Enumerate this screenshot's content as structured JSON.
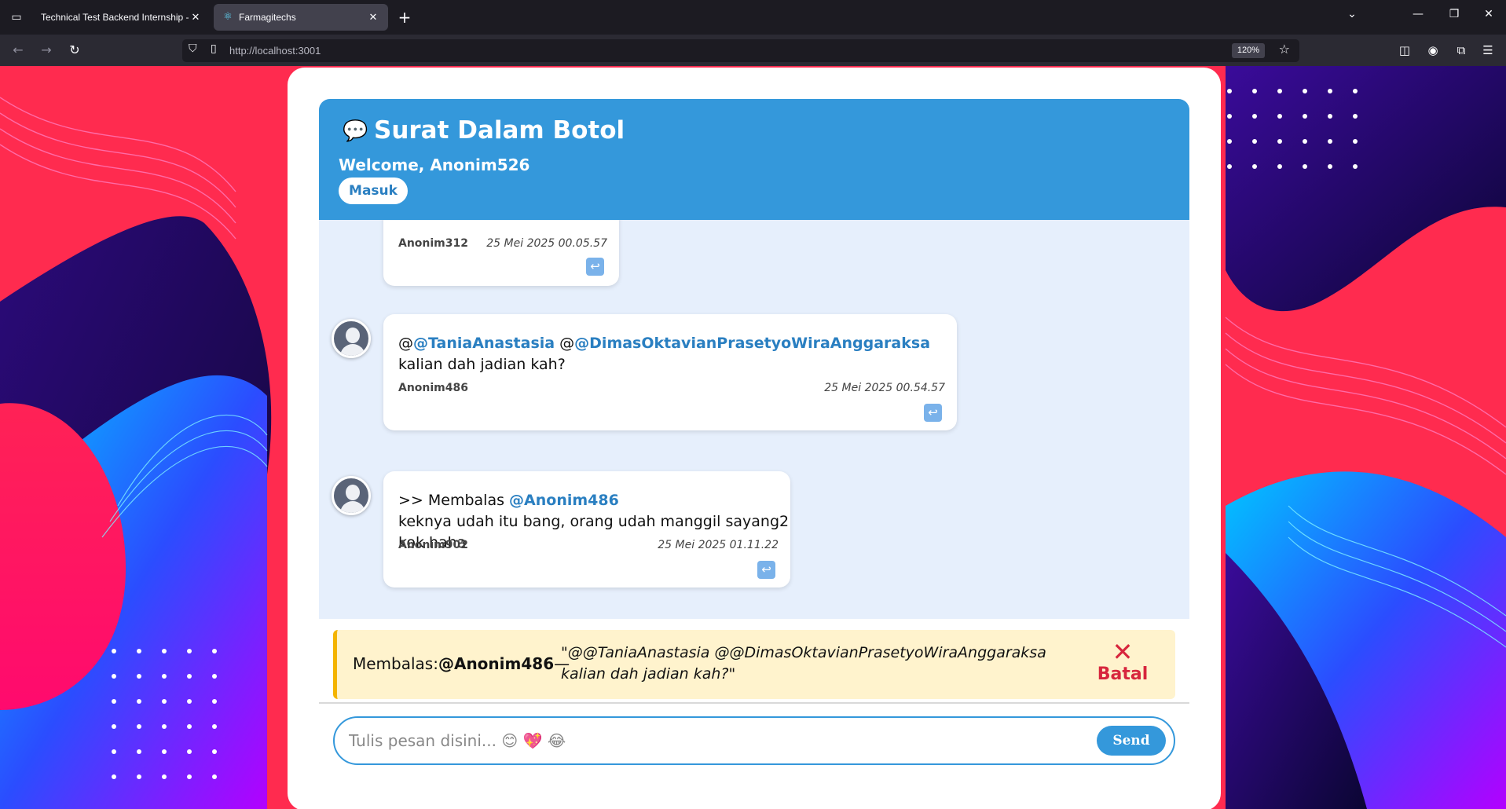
{
  "browser": {
    "tabs": [
      {
        "title": "Technical Test Backend Internship - "
      },
      {
        "title": "Farmagitechs"
      }
    ],
    "url": "http://localhost:3001",
    "zoom": "120%"
  },
  "app": {
    "title": "Surat Dalam Botol",
    "logo_icon": "💬",
    "welcome": "Welcome, Anonim526",
    "login_label": "Masuk"
  },
  "messages": [
    {
      "sender": "Anonim312",
      "time": "25 Mei 2025 00.05.57"
    },
    {
      "parts": [
        "@",
        "@TaniaAnastasia",
        " @",
        "@DimasOktavianPrasetyoWiraAnggaraksa",
        " kalian dah jadian kah?"
      ],
      "sender": "Anonim486",
      "time": "25 Mei 2025 00.54.57"
    },
    {
      "prefix": ">> Membalas ",
      "mention": "@Anonim486",
      "body": "keknya udah itu bang, orang udah manggil sayang2 kok haha",
      "sender": "Anonim902",
      "time": "25 Mei 2025 01.11.22"
    }
  ],
  "reply": {
    "label": "Membalas:",
    "user": "@Anonim486",
    "dash": "—",
    "quote": "\"@@TaniaAnastasia @@DimasOktavianPrasetyoWiraAnggaraksa kalian dah jadian kah?\"",
    "cancel_icon": "✕",
    "cancel_label": "Batal"
  },
  "composer": {
    "placeholder": "Tulis pesan disini... 😊 💖 😂",
    "send_label": "Send"
  },
  "colors": {
    "primary": "#3498db",
    "mention": "#2a7fc1",
    "reply_bg": "#fff3cd",
    "cancel": "#d7263d"
  }
}
